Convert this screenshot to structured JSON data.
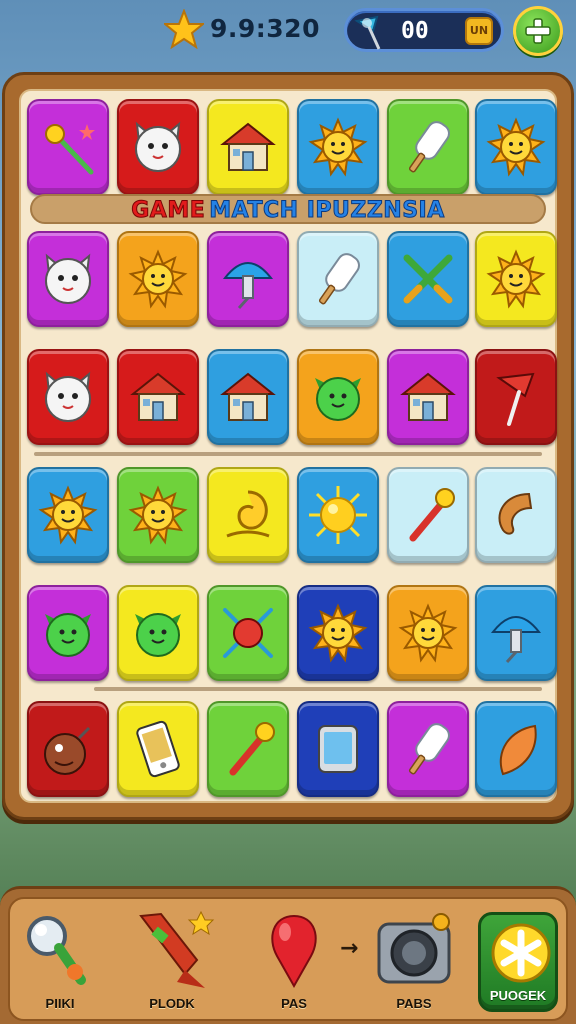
{
  "hud": {
    "score": "9.9:320",
    "coins": "00",
    "coin_badge": "UN"
  },
  "banner": {
    "word1": "GAME",
    "word2": "MATCH IPUZZNSIA"
  },
  "board": {
    "rows": [
      [
        {
          "color": "#c42fd9",
          "icon": "magic-wand-icon"
        },
        {
          "color": "#d61b1b",
          "icon": "cat-face-icon"
        },
        {
          "color": "#f4e81f",
          "icon": "house-icon"
        },
        {
          "color": "#2f9fe0",
          "icon": "sun-face-icon"
        },
        {
          "color": "#6fd23b",
          "icon": "popsicle-icon"
        },
        {
          "color": "#2f9fe0",
          "icon": "sun-face-icon"
        }
      ],
      [
        {
          "color": "#c42fd9",
          "icon": "cat-face-icon"
        },
        {
          "color": "#f4a31c",
          "icon": "sun-face-icon"
        },
        {
          "color": "#c42fd9",
          "icon": "mushroom-icon"
        },
        {
          "color": "#c9eef7",
          "icon": "popsicle-icon"
        },
        {
          "color": "#2f9fe0",
          "icon": "crossed-swords-icon"
        },
        {
          "color": "#f4e81f",
          "icon": "sun-face-icon"
        }
      ],
      [
        {
          "color": "#d61b1b",
          "icon": "cat-face-icon"
        },
        {
          "color": "#d61b1b",
          "icon": "house-icon"
        },
        {
          "color": "#2f9fe0",
          "icon": "house-icon"
        },
        {
          "color": "#f4a31c",
          "icon": "blob-face-icon"
        },
        {
          "color": "#c42fd9",
          "icon": "house-icon"
        },
        {
          "color": "#c11a1a",
          "icon": "pin-icon"
        }
      ],
      [
        {
          "color": "#2f9fe0",
          "icon": "sun-face-icon"
        },
        {
          "color": "#6fd23b",
          "icon": "sun-face-icon"
        },
        {
          "color": "#f4e81f",
          "icon": "snail-icon"
        },
        {
          "color": "#2f9fe0",
          "icon": "sun-icon"
        },
        {
          "color": "#c9eef7",
          "icon": "torch-icon"
        },
        {
          "color": "#c9eef7",
          "icon": "horseshoe-icon"
        }
      ],
      [
        {
          "color": "#c42fd9",
          "icon": "blob-face-icon"
        },
        {
          "color": "#f4e81f",
          "icon": "blob-face-icon"
        },
        {
          "color": "#6fd23b",
          "icon": "bug-icon"
        },
        {
          "color": "#1f3fb8",
          "icon": "sun-face-icon"
        },
        {
          "color": "#f4a31c",
          "icon": "sun-face-icon"
        },
        {
          "color": "#2f9fe0",
          "icon": "mushroom-icon"
        }
      ],
      [
        {
          "color": "#c11a1a",
          "icon": "bomb-icon"
        },
        {
          "color": "#f4e81f",
          "icon": "phone-icon"
        },
        {
          "color": "#6fd23b",
          "icon": "torch-icon"
        },
        {
          "color": "#1f3fb8",
          "icon": "tablet-icon"
        },
        {
          "color": "#c42fd9",
          "icon": "popsicle-icon"
        },
        {
          "color": "#2f9fe0",
          "icon": "leaf-icon"
        }
      ]
    ]
  },
  "tools": [
    {
      "label": "PIIKI",
      "icon": "magnifier-icon"
    },
    {
      "label": "PLODK",
      "icon": "rocket-icon"
    },
    {
      "label": "PAS",
      "icon": "balloon-icon"
    },
    {
      "label": "PABS",
      "icon": "camera-icon"
    }
  ],
  "rescue": {
    "label": "PUOGEK",
    "icon": "asterisk-icon"
  }
}
